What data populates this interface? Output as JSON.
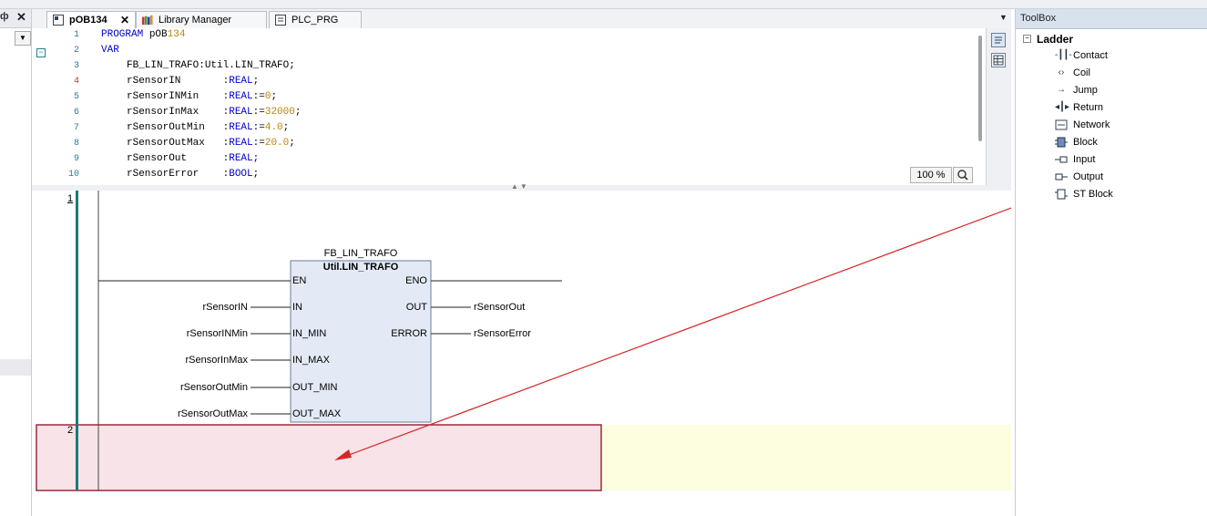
{
  "tabs": [
    {
      "label": "pOB134",
      "active": true,
      "closable": true
    },
    {
      "label": "Library Manager",
      "active": false
    },
    {
      "label": "PLC_PRG",
      "active": false
    }
  ],
  "declaration": {
    "lines": [
      {
        "num": "1",
        "text": "PROGRAM pOB134"
      },
      {
        "num": "2",
        "text": "VAR"
      },
      {
        "num": "3",
        "text": "FB_LIN_TRAFO:Util.LIN_TRAFO;"
      },
      {
        "num": "4",
        "text": "rSensorIN       :REAL;"
      },
      {
        "num": "5",
        "text": "rSensorINMin    :REAL:=0;"
      },
      {
        "num": "6",
        "text": "rSensorInMax    :REAL:=32000;"
      },
      {
        "num": "7",
        "text": "rSensorOutMin   :REAL:=4.0;"
      },
      {
        "num": "8",
        "text": "rSensorOutMax   :REAL:=20.0;"
      },
      {
        "num": "9",
        "text": "rSensorOut      :REAL;"
      },
      {
        "num": "10",
        "text": "rSensorError    :BOOL;"
      }
    ],
    "zoom": "100 %"
  },
  "ladder": {
    "networks": [
      {
        "num": "1"
      },
      {
        "num": "2"
      }
    ],
    "block": {
      "instance": "FB_LIN_TRAFO",
      "type": "Util.LIN_TRAFO",
      "inputs": [
        "EN",
        "IN",
        "IN_MIN",
        "IN_MAX",
        "OUT_MIN",
        "OUT_MAX"
      ],
      "outputs": [
        "ENO",
        "OUT",
        "ERROR"
      ],
      "input_vars": [
        "rSensorIN",
        "rSensorINMin",
        "rSensorInMax",
        "rSensorOutMin",
        "rSensorOutMax"
      ],
      "output_vars": [
        "rSensorOut",
        "rSensorError"
      ]
    }
  },
  "toolbox": {
    "title": "ToolBox",
    "category": "Ladder",
    "items": [
      {
        "label": "Contact",
        "icon": "contact-icon"
      },
      {
        "label": "Coil",
        "icon": "coil-icon"
      },
      {
        "label": "Jump",
        "icon": "jump-icon"
      },
      {
        "label": "Return",
        "icon": "return-icon"
      },
      {
        "label": "Network",
        "icon": "network-icon"
      },
      {
        "label": "Block",
        "icon": "block-icon"
      },
      {
        "label": "Input",
        "icon": "input-icon"
      },
      {
        "label": "Output",
        "icon": "output-icon"
      },
      {
        "label": "ST Block",
        "icon": "st-block-icon"
      }
    ]
  },
  "colors": {
    "accent": "#d62728",
    "network_rail": "#1a7a7a",
    "block_fill": "#e3eaf5",
    "drop_zone": "#f7e3e8",
    "drop_border": "#9b2a3a",
    "highlight_row": "#fdfde0"
  }
}
